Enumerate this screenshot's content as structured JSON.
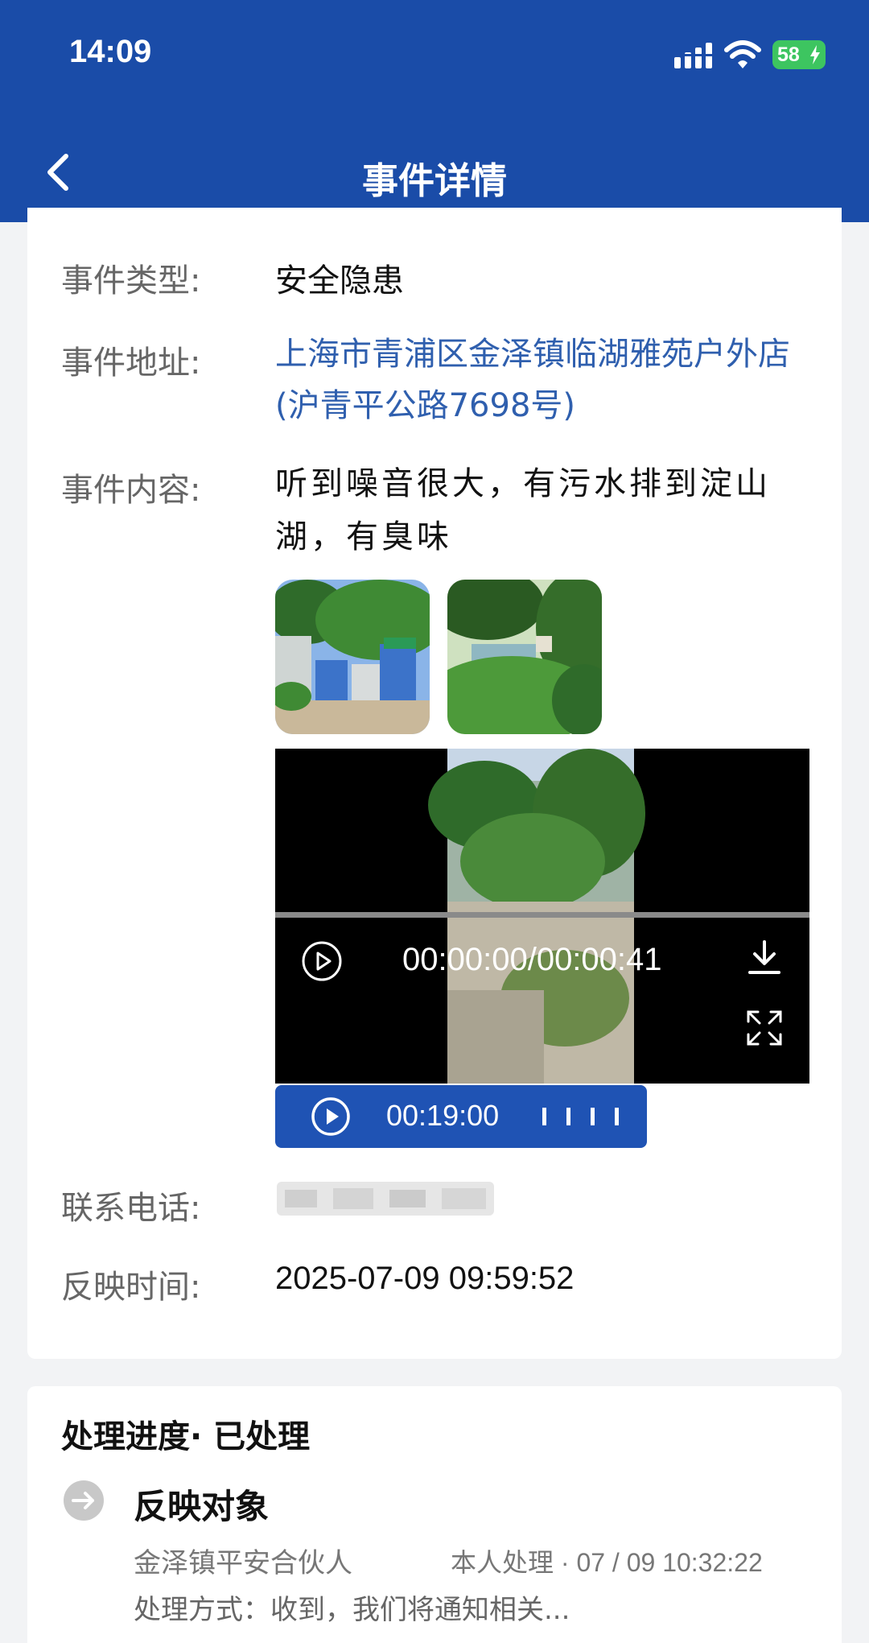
{
  "status_bar": {
    "time": "14:09",
    "battery": "58"
  },
  "nav": {
    "title": "事件详情"
  },
  "details": {
    "type_label": "事件类型:",
    "type_value": "安全隐患",
    "address_label": "事件地址:",
    "address_value": "上海市青浦区金泽镇临湖雅苑户外店(沪青平公路7698号)",
    "content_label": "事件内容:",
    "content_value": "听到噪音很大，有污水排到淀山湖，有臭味",
    "phone_label": "联系电话:",
    "report_time_label": "反映时间:",
    "report_time_value": "2025-07-09 09:59:52"
  },
  "video": {
    "time": "00:00:00/00:00:41"
  },
  "audio": {
    "duration": "00:19:00"
  },
  "progress": {
    "title": "处理进度· 已处理",
    "step_title": "反映对象",
    "step_org": "金泽镇平安合伙人",
    "step_meta": "本人处理 · 07 / 09 10:32:22",
    "step_method": "处理方式：收到，我们将通知相关..."
  },
  "icons": [
    "chevron-left-icon",
    "signal-icon",
    "wifi-icon",
    "battery-icon",
    "play-icon",
    "download-icon",
    "fullscreen-icon",
    "arrow-right-circle-icon"
  ],
  "colors": {
    "header": "#1a4ca8",
    "link": "#2f5fae",
    "audio": "#1f53b4",
    "battery": "#3dc560"
  }
}
